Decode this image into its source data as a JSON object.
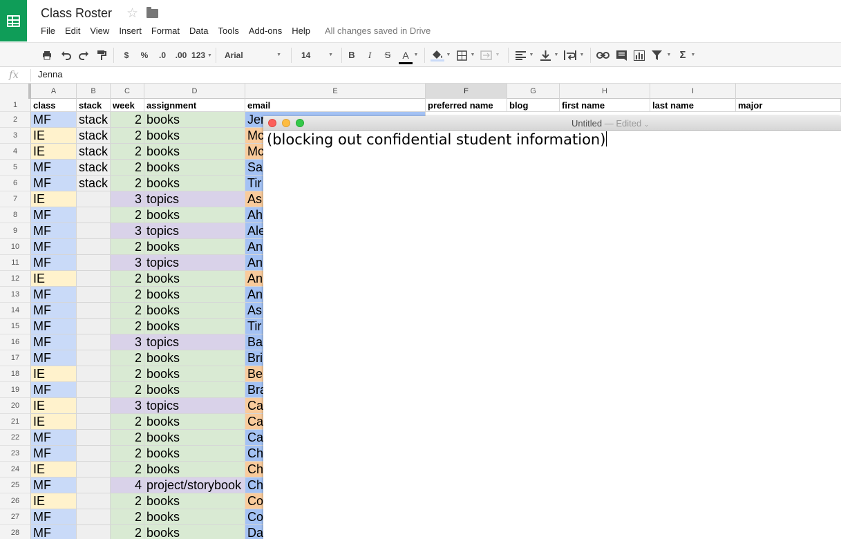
{
  "app": {
    "title": "Class Roster",
    "menu": [
      "File",
      "Edit",
      "View",
      "Insert",
      "Format",
      "Data",
      "Tools",
      "Add-ons",
      "Help"
    ],
    "save_status": "All changes saved in Drive",
    "icons": [
      "sheets-logo-icon",
      "star-icon",
      "folder-icon"
    ]
  },
  "toolbar": {
    "currency": "$",
    "percent": "%",
    "decrease_decimal": ".0",
    "increase_decimal": ".00",
    "more_formats": "123",
    "font": "Arial",
    "font_size": "14",
    "bold": "B",
    "italic": "I",
    "strikethrough": "S",
    "text_color": "A",
    "sum": "Σ"
  },
  "formula_bar": {
    "fx": "fx",
    "value": "Jenna"
  },
  "sheet": {
    "columns": [
      "A",
      "B",
      "C",
      "D",
      "E",
      "F",
      "G",
      "H",
      "I"
    ],
    "selected_column": "F",
    "header_row": {
      "number": "1",
      "cells": [
        "class",
        "stack",
        "week",
        "assignment",
        "email",
        "preferred name",
        "blog",
        "first name",
        "last name",
        "major"
      ]
    },
    "rows": [
      {
        "n": "2",
        "cls": "MF",
        "stack": "stack",
        "week": "2",
        "assignment": "books",
        "email": "Jer"
      },
      {
        "n": "3",
        "cls": "IE",
        "stack": "stack",
        "week": "2",
        "assignment": "books",
        "email": "Mc"
      },
      {
        "n": "4",
        "cls": "IE",
        "stack": "stack",
        "week": "2",
        "assignment": "books",
        "email": "Mc"
      },
      {
        "n": "5",
        "cls": "MF",
        "stack": "stack",
        "week": "2",
        "assignment": "books",
        "email": "Sa"
      },
      {
        "n": "6",
        "cls": "MF",
        "stack": "stack",
        "week": "2",
        "assignment": "books",
        "email": "Tir"
      },
      {
        "n": "7",
        "cls": "IE",
        "stack": "",
        "week": "3",
        "assignment": "topics",
        "email": "As"
      },
      {
        "n": "8",
        "cls": "MF",
        "stack": "",
        "week": "2",
        "assignment": "books",
        "email": "Ah"
      },
      {
        "n": "9",
        "cls": "MF",
        "stack": "",
        "week": "3",
        "assignment": "topics",
        "email": "Ale"
      },
      {
        "n": "10",
        "cls": "MF",
        "stack": "",
        "week": "2",
        "assignment": "books",
        "email": "An"
      },
      {
        "n": "11",
        "cls": "MF",
        "stack": "",
        "week": "3",
        "assignment": "topics",
        "email": "An"
      },
      {
        "n": "12",
        "cls": "IE",
        "stack": "",
        "week": "2",
        "assignment": "books",
        "email": "An"
      },
      {
        "n": "13",
        "cls": "MF",
        "stack": "",
        "week": "2",
        "assignment": "books",
        "email": "An"
      },
      {
        "n": "14",
        "cls": "MF",
        "stack": "",
        "week": "2",
        "assignment": "books",
        "email": "As"
      },
      {
        "n": "15",
        "cls": "MF",
        "stack": "",
        "week": "2",
        "assignment": "books",
        "email": "Tir"
      },
      {
        "n": "16",
        "cls": "MF",
        "stack": "",
        "week": "3",
        "assignment": "topics",
        "email": "Ba"
      },
      {
        "n": "17",
        "cls": "MF",
        "stack": "",
        "week": "2",
        "assignment": "books",
        "email": "Bri"
      },
      {
        "n": "18",
        "cls": "IE",
        "stack": "",
        "week": "2",
        "assignment": "books",
        "email": "Be"
      },
      {
        "n": "19",
        "cls": "MF",
        "stack": "",
        "week": "2",
        "assignment": "books",
        "email": "Bra"
      },
      {
        "n": "20",
        "cls": "IE",
        "stack": "",
        "week": "3",
        "assignment": "topics",
        "email": "Ca"
      },
      {
        "n": "21",
        "cls": "IE",
        "stack": "",
        "week": "2",
        "assignment": "books",
        "email": "Ca"
      },
      {
        "n": "22",
        "cls": "MF",
        "stack": "",
        "week": "2",
        "assignment": "books",
        "email": "Ca"
      },
      {
        "n": "23",
        "cls": "MF",
        "stack": "",
        "week": "2",
        "assignment": "books",
        "email": "Ch"
      },
      {
        "n": "24",
        "cls": "IE",
        "stack": "",
        "week": "2",
        "assignment": "books",
        "email": "Ch"
      },
      {
        "n": "25",
        "cls": "MF",
        "stack": "",
        "week": "4",
        "assignment": "project/storybook",
        "email": "Ch"
      },
      {
        "n": "26",
        "cls": "IE",
        "stack": "",
        "week": "2",
        "assignment": "books",
        "email": "Co"
      },
      {
        "n": "27",
        "cls": "MF",
        "stack": "",
        "week": "2",
        "assignment": "books",
        "email": "Co"
      },
      {
        "n": "28",
        "cls": "MF",
        "stack": "",
        "week": "2",
        "assignment": "books",
        "email": "Da"
      }
    ]
  },
  "textedit": {
    "title": "Untitled",
    "edited": "— Edited",
    "body": "(blocking out confidential student information)"
  },
  "colors": {
    "sheets_green": "#0f9d58",
    "mf": "#c9daf8",
    "ie": "#fff2cc",
    "books": "#d9ead3",
    "topics": "#d9d2e9",
    "email_mf": "#a4c2f4",
    "email_ie": "#f9cb9c"
  }
}
